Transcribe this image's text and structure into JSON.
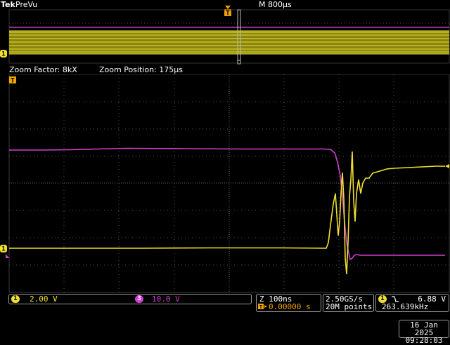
{
  "header": {
    "brand": "Tek",
    "mode": "PreVu",
    "timebase": "M 800µs"
  },
  "zoom": {
    "factor_text": "Zoom Factor: 8kX",
    "position_text": "Zoom Position: 175µs"
  },
  "markers": {
    "trigger": "T",
    "channel1": "1"
  },
  "channels": [
    {
      "badge": "1",
      "scale": "2.00 V",
      "color": "#f0e030"
    },
    {
      "badge": "3",
      "scale": "10.0 V",
      "color": "#d040d0"
    }
  ],
  "horizontal": {
    "label": "Z 100ns",
    "position": "0.00000 s"
  },
  "acquisition": {
    "sample_rate": "2.50GS/s",
    "record_length": "20M points"
  },
  "trigger": {
    "source": "1",
    "slope_icon": "falling-edge-icon",
    "level": "6.88 V",
    "frequency": "263.639kHz"
  },
  "datetime": {
    "date": "16 Jan  2025",
    "time": "09:28:03"
  },
  "colors": {
    "ch1": "#f0e030",
    "ch3": "#d040d0",
    "trigger": "#f0a000",
    "grid": "#5a5a5a"
  }
}
